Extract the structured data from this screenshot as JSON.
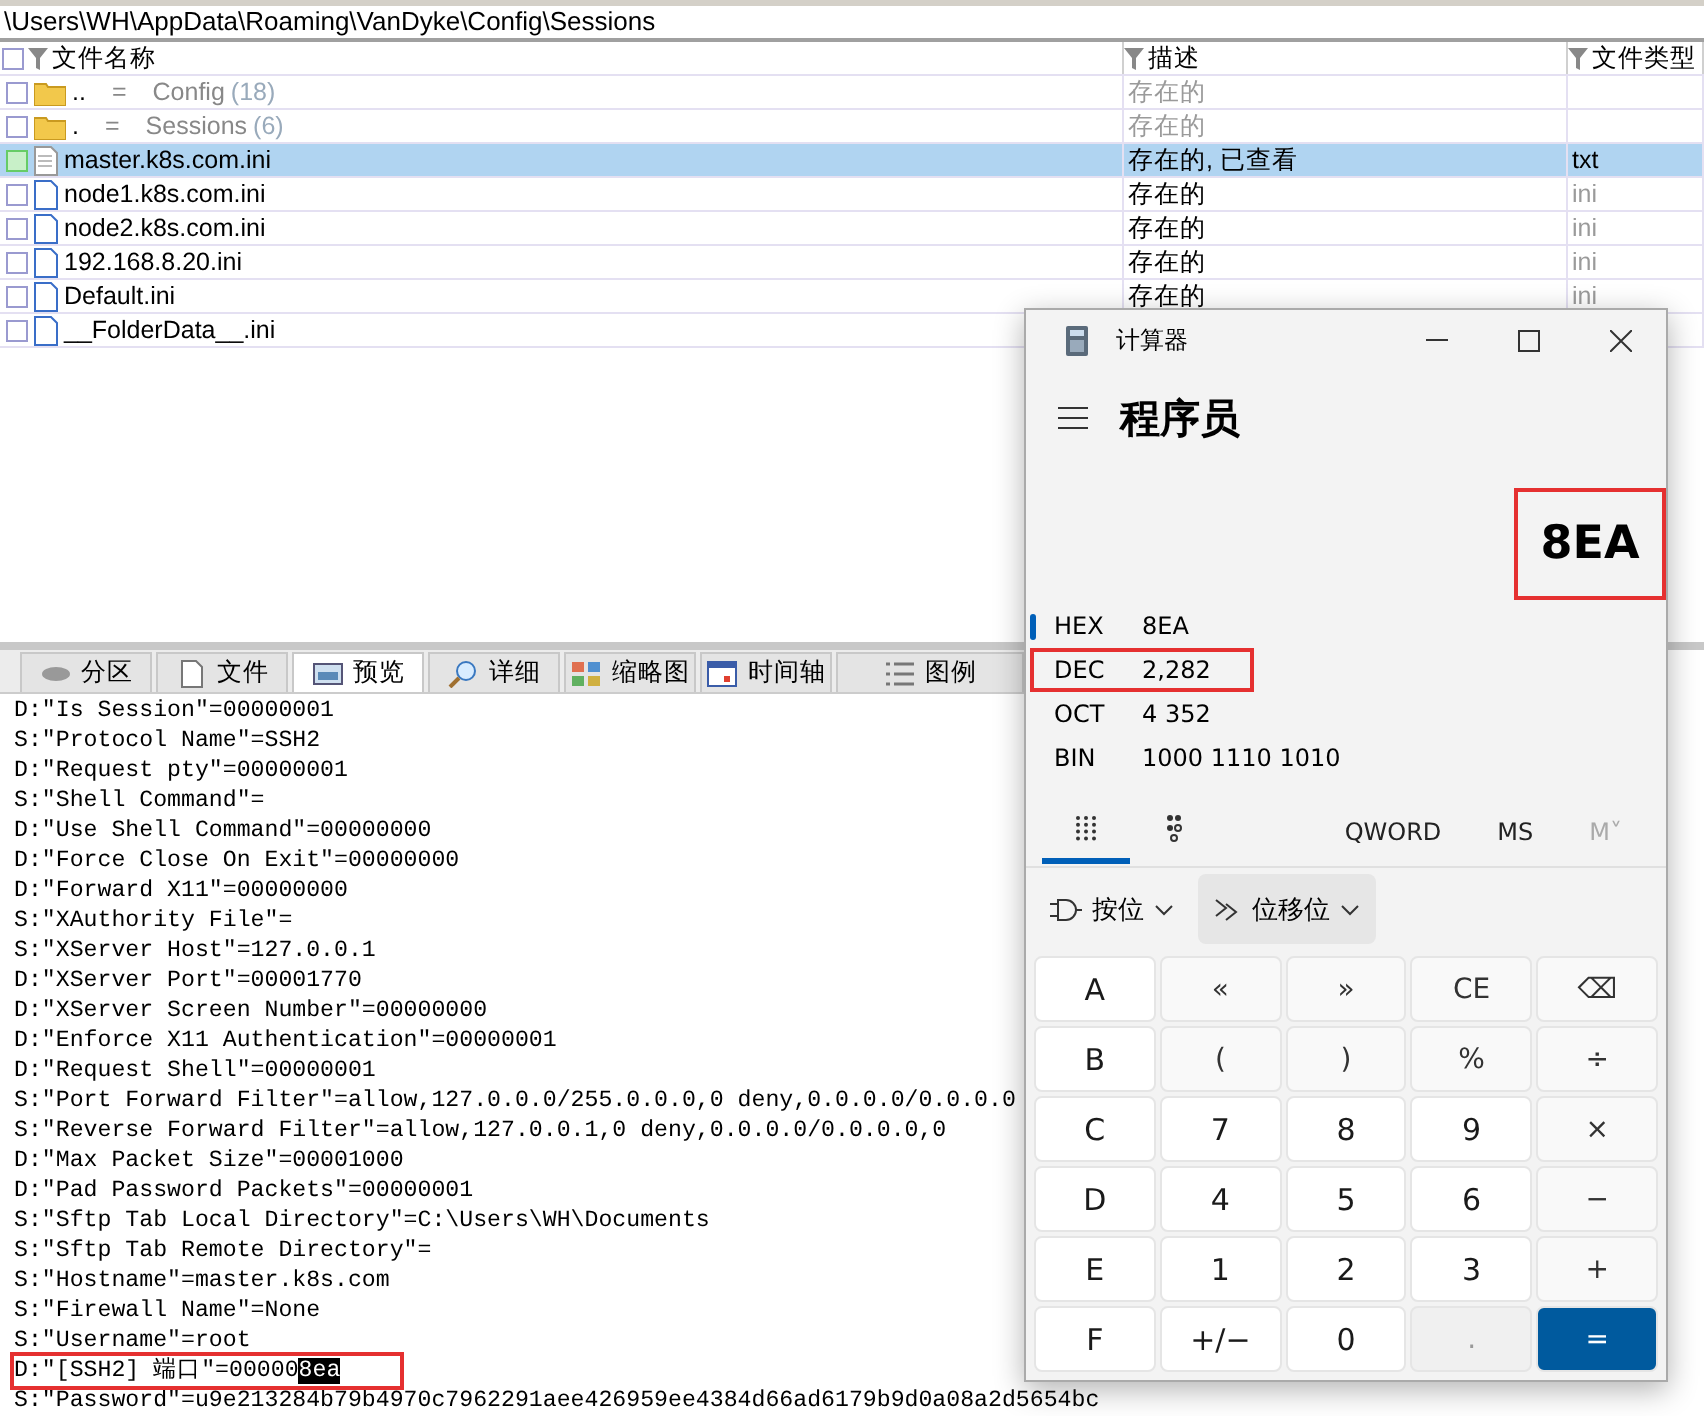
{
  "path_bar": "\\Users\\WH\\AppData\\Roaming\\VanDyke\\Config\\Sessions",
  "file_list": {
    "select_all_checked": false,
    "columns": [
      "文件名称",
      "描述",
      "文件类型"
    ],
    "rows": [
      {
        "kind": "folder",
        "name": "..",
        "separator": "=",
        "label": "Config",
        "count": "(18)",
        "description": "存在的",
        "type": "",
        "selected": false
      },
      {
        "kind": "folder",
        "name": ".",
        "separator": "=",
        "label": "Sessions",
        "count": "(6)",
        "description": "存在的",
        "type": "",
        "selected": false
      },
      {
        "kind": "text-file",
        "name": "master.k8s.com.ini",
        "description": "存在的, 已查看",
        "type": "txt",
        "selected": true
      },
      {
        "kind": "file",
        "name": "node1.k8s.com.ini",
        "description": "存在的",
        "type": "ini",
        "selected": false
      },
      {
        "kind": "file",
        "name": "node2.k8s.com.ini",
        "description": "存在的",
        "type": "ini",
        "selected": false
      },
      {
        "kind": "file",
        "name": "192.168.8.20.ini",
        "description": "存在的",
        "type": "ini",
        "selected": false
      },
      {
        "kind": "file",
        "name": "Default.ini",
        "description": "存在的",
        "type": "ini",
        "selected": false
      },
      {
        "kind": "file",
        "name": "__FolderData__.ini",
        "description": "",
        "type": "",
        "selected": false
      }
    ]
  },
  "view_tabs": [
    {
      "label": "分区",
      "selected": false
    },
    {
      "label": "文件",
      "selected": false
    },
    {
      "label": "预览",
      "selected": true
    },
    {
      "label": "详细",
      "selected": false
    },
    {
      "label": "缩略图",
      "selected": false
    },
    {
      "label": "时间轴",
      "selected": false
    },
    {
      "label": "图例",
      "selected": false
    }
  ],
  "preview_lines": [
    {
      "text": "D:\"Is Session\"=00000001"
    },
    {
      "text": "S:\"Protocol Name\"=SSH2"
    },
    {
      "text": "D:\"Request pty\"=00000001"
    },
    {
      "text": "S:\"Shell Command\"="
    },
    {
      "text": "D:\"Use Shell Command\"=00000000"
    },
    {
      "text": "D:\"Force Close On Exit\"=00000000"
    },
    {
      "text": "D:\"Forward X11\"=00000000"
    },
    {
      "text": "S:\"XAuthority File\"="
    },
    {
      "text": "S:\"XServer Host\"=127.0.0.1"
    },
    {
      "text": "D:\"XServer Port\"=00001770"
    },
    {
      "text": "D:\"XServer Screen Number\"=00000000"
    },
    {
      "text": "D:\"Enforce X11 Authentication\"=00000001"
    },
    {
      "text": "D:\"Request Shell\"=00000001"
    },
    {
      "text": "S:\"Port Forward Filter\"=allow,127.0.0.0/255.0.0.0,0 deny,0.0.0.0/0.0.0.0"
    },
    {
      "text": "S:\"Reverse Forward Filter\"=allow,127.0.0.1,0 deny,0.0.0.0/0.0.0.0,0"
    },
    {
      "text": "D:\"Max Packet Size\"=00001000"
    },
    {
      "text": "D:\"Pad Password Packets\"=00000001"
    },
    {
      "text": "S:\"Sftp Tab Local Directory\"=C:\\Users\\WH\\Documents"
    },
    {
      "text": "S:\"Sftp Tab Remote Directory\"="
    },
    {
      "text": "S:\"Hostname\"=master.k8s.com"
    },
    {
      "text": "S:\"Firewall Name\"=None"
    },
    {
      "text": "S:\"Username\"=root"
    },
    {
      "text": "D:\"[SSH2] 端口\"=00000",
      "selection": "8ea",
      "highlight": true
    },
    {
      "text": "S:\"Password\"=u9e213284b79b4970c7962291aee426959ee4384d66ad6179b9d0a08a2d5654bc"
    }
  ],
  "calculator": {
    "title": "计算器",
    "mode": "程序员",
    "display": "8EA",
    "display_highlight": true,
    "radix": [
      {
        "name": "HEX",
        "value": "8EA",
        "selected": true,
        "highlight": false
      },
      {
        "name": "DEC",
        "value": "2,282",
        "selected": false,
        "highlight": true
      },
      {
        "name": "OCT",
        "value": "4 352",
        "selected": false,
        "highlight": false
      },
      {
        "name": "BIN",
        "value": "1000 1110 1010",
        "selected": false,
        "highlight": false
      }
    ],
    "keypad_tabs": [
      {
        "kind": "keypad",
        "selected": true
      },
      {
        "kind": "bits",
        "selected": false
      }
    ],
    "memory": [
      {
        "label": "QWORD",
        "disabled": false
      },
      {
        "label": "MS",
        "disabled": false
      },
      {
        "label": "M˅",
        "disabled": true
      }
    ],
    "menus": [
      {
        "kind": "bitwise",
        "label": "按位",
        "selected": false
      },
      {
        "kind": "shift",
        "label": "位移位",
        "selected": true
      }
    ],
    "keys": [
      {
        "label": "A",
        "kind": "digit"
      },
      {
        "label": "«",
        "kind": "op"
      },
      {
        "label": "»",
        "kind": "op"
      },
      {
        "label": "CE",
        "kind": "op"
      },
      {
        "label": "⌫",
        "kind": "op"
      },
      {
        "label": "B",
        "kind": "digit"
      },
      {
        "label": "(",
        "kind": "op"
      },
      {
        "label": ")",
        "kind": "op"
      },
      {
        "label": "%",
        "kind": "op"
      },
      {
        "label": "÷",
        "kind": "op"
      },
      {
        "label": "C",
        "kind": "digit"
      },
      {
        "label": "7",
        "kind": "digit"
      },
      {
        "label": "8",
        "kind": "digit"
      },
      {
        "label": "9",
        "kind": "digit"
      },
      {
        "label": "×",
        "kind": "op"
      },
      {
        "label": "D",
        "kind": "digit"
      },
      {
        "label": "4",
        "kind": "digit"
      },
      {
        "label": "5",
        "kind": "digit"
      },
      {
        "label": "6",
        "kind": "digit"
      },
      {
        "label": "−",
        "kind": "op"
      },
      {
        "label": "E",
        "kind": "digit"
      },
      {
        "label": "1",
        "kind": "digit"
      },
      {
        "label": "2",
        "kind": "digit"
      },
      {
        "label": "3",
        "kind": "digit"
      },
      {
        "label": "+",
        "kind": "op"
      },
      {
        "label": "F",
        "kind": "digit"
      },
      {
        "label": "+/−",
        "kind": "digit"
      },
      {
        "label": "0",
        "kind": "digit"
      },
      {
        "label": ".",
        "kind": "disabled"
      },
      {
        "label": "=",
        "kind": "accent"
      }
    ]
  }
}
